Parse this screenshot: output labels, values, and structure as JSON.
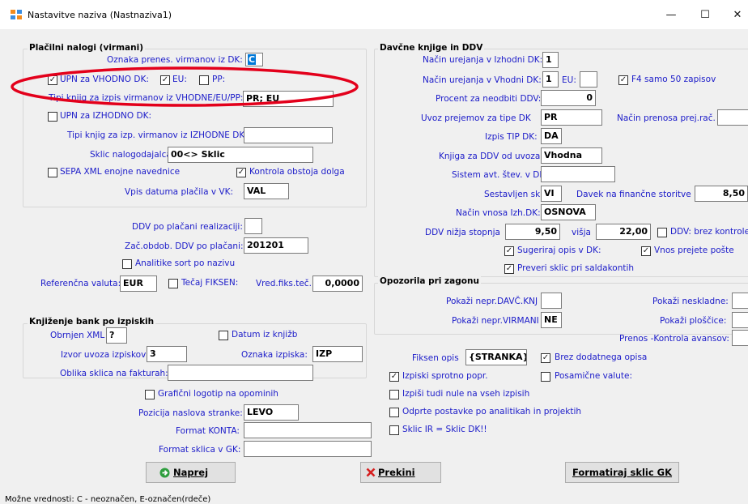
{
  "window": {
    "title": "Nastavitve naziva (Nastnaziva1)",
    "minimize": "—",
    "maximize": "☐",
    "close": "✕"
  },
  "placilni": {
    "title": "Plačilni nalogi (virmani)",
    "oznaka_label": "Oznaka prenes. virmanov iz DK:",
    "oznaka_value": "C",
    "upn_vhodno_label": "UPN za VHODNO DK:",
    "upn_vhodno_checked": true,
    "eu_label": "EU:",
    "eu_checked": true,
    "pp_label": "PP:",
    "pp_checked": false,
    "tipi_vhodne_label": "Tipi knjig za izpis virmanov iz VHODNE/EU/PP:",
    "tipi_vhodne_value": "PR; EU",
    "upn_izhodno_label": "UPN za IZHODNO DK:",
    "upn_izhodno_checked": false,
    "tipi_izhodne_label": "Tipi knjig za izp. virmanov iz IZHODNE DK:",
    "tipi_izhodne_value": "",
    "sklic_label": "Sklic nalogodajalca:",
    "sklic_value": "00<> Sklic",
    "sepa_label": "SEPA XML enojne navednice",
    "sepa_checked": false,
    "kontrola_label": "Kontrola obstoja dolga",
    "kontrola_checked": true,
    "vpis_label": "Vpis datuma plačila v VK:",
    "vpis_value": "VAL"
  },
  "middle": {
    "ddv_real_label": "DDV po plačani realizaciji:",
    "ddv_real_value": "",
    "zac_obdob_label": "Zač.obdob. DDV po plačani:",
    "zac_obdob_value": "201201",
    "analitike_label": "Analitike sort po nazivu",
    "analitike_checked": false,
    "ref_valuta_label": "Referenčna valuta:",
    "ref_valuta_value": "EUR",
    "tecaj_label": "Tečaj FIKSEN:",
    "tecaj_checked": false,
    "vred_label": "Vred.fiks.teč.:",
    "vred_value": "0,0000"
  },
  "knjizenje": {
    "title": "Knjiženje bank po izpiskih",
    "obrnjen_label": "Obrnjen XML",
    "obrnjen_value": "?",
    "datum_label": "Datum iz knjižb",
    "datum_checked": false,
    "izvor_label": "Izvor uvoza izpiskov:",
    "izvor_value": "3",
    "oznaka_izp_label": "Oznaka izpiska:",
    "oznaka_izp_value": "IZP",
    "oblika_label": "Oblika sklica na fakturah:",
    "oblika_value": ""
  },
  "bottom_left": {
    "graficni_label": "Grafični logotip na opominih",
    "graficni_checked": false,
    "pozicija_label": "Pozicija naslova stranke:",
    "pozicija_value": "LEVO",
    "format_konta_label": "Format KONTA:",
    "format_konta_value": "",
    "format_sklica_label": "Format sklica v GK:",
    "format_sklica_value": ""
  },
  "davcne": {
    "title": "Davčne knjige in DDV",
    "nacin_izh_label": "Način urejanja v Izhodni DK:",
    "nacin_izh_value": "1",
    "nacin_vh_label": "Način urejanja v Vhodni DK:",
    "nacin_vh_value": "1",
    "eu_label": "EU:",
    "eu_value": "",
    "f4_label": "F4 samo 50 zapisov",
    "f4_checked": true,
    "procent_label": "Procent za neodbiti DDV:",
    "procent_value": "0",
    "uvoz_label": "Uvoz prejemov za tipe DK",
    "uvoz_value": "PR",
    "nacin_prenosa_label": "Način prenosa prej.rač.",
    "nacin_prenosa_value": "",
    "izpis_tip_label": "Izpis TIP DK:",
    "izpis_tip_value": "DA",
    "knjiga_label": "Knjiga za DDV od uvoza:",
    "knjiga_value": "Vhodna",
    "sistem_label": "Sistem avt. štev. v DK:",
    "sistem_value": "",
    "sestavljen_label": "Sestavljen sklic",
    "sestavljen_value": "VI",
    "davek_label": "Davek na finančne storitve",
    "davek_value": "8,50",
    "nacin_vnosa_label": "Način vnosa Izh.DK:",
    "nacin_vnosa_value": "OSNOVA",
    "ddv_nizja_label": "DDV nižja stopnja",
    "ddv_nizja_value": "9,50",
    "visja_label": "višja",
    "visja_value": "22,00",
    "brez_kontrole_label": "DDV: brez kontrole",
    "brez_kontrole_checked": false,
    "sugeriraj_label": "Sugeriraj opis v DK:",
    "sugeriraj_checked": true,
    "vnos_label": "Vnos prejete pošte",
    "vnos_checked": true,
    "preveri_label": "Preveri sklic pri saldakontih",
    "preveri_checked": true
  },
  "opozorila": {
    "title": "Opozorila pri zagonu",
    "davc_label": "Pokaži nepr.DAVČ.KNJ",
    "davc_value": "",
    "virmani_label": "Pokaži nepr.VIRMANI",
    "virmani_value": "NE",
    "neskladne_label": "Pokaži neskladne:",
    "neskladne_value": "",
    "ploscice_label": "Pokaži ploščice:",
    "ploscice_value": "",
    "prenos_label": "Prenos -Kontrola avansov:",
    "prenos_value": ""
  },
  "right_bottom": {
    "fiksen_label": "Fiksen opis",
    "fiksen_value": "{STRANKA}",
    "brez_opisa_label": "Brez dodatnega opisa",
    "brez_opisa_checked": true,
    "izpiski_label": "Izpiski sprotno popr.",
    "izpiski_checked": true,
    "posamicne_label": "Posamične valute:",
    "posamicne_checked": false,
    "izpisi_nule_label": "Izpiši tudi nule na vseh izpisih",
    "izpisi_nule_checked": false,
    "odprte_label": "Odprte postavke po analitikah in projektih",
    "odprte_checked": false,
    "sklic_ir_label": "Sklic IR = Sklic DK!!",
    "sklic_ir_checked": false
  },
  "buttons": {
    "naprej": "Naprej",
    "prekini": "Prekini",
    "formatiraj": "Formatiraj sklic GK"
  },
  "status": "Možne vrednosti: C - neoznačen, E-označen(rdeče)",
  "colors": {
    "label_blue": "#1b1bc9",
    "annotation_red": "#e3001b",
    "green_icon": "#2e9e3e",
    "red_x": "#d61f1f"
  }
}
